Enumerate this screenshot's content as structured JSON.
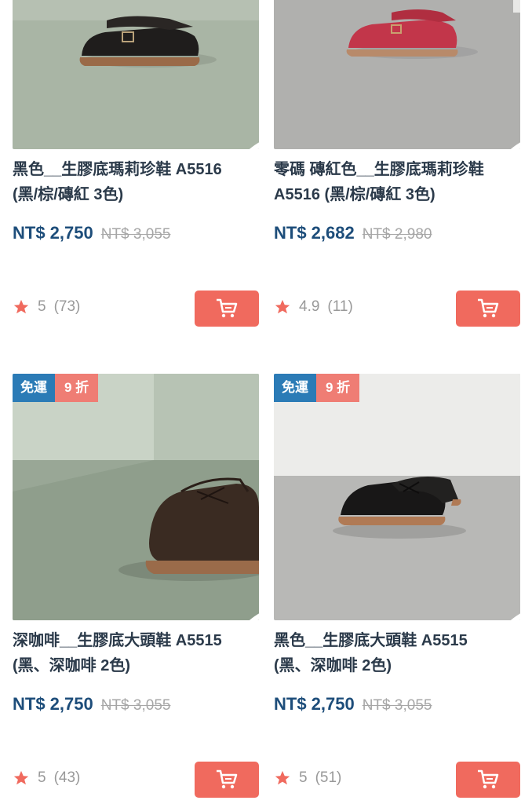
{
  "products": [
    {
      "title_line1": "黑色__生膠底瑪莉珍鞋 A5516",
      "title_line2": "(黑/棕/磚紅 3色)",
      "price": "NT$ 2,750",
      "original_price": "NT$ 3,055",
      "rating": "5",
      "reviews": "(73)",
      "image": "black-mary-jane-shoe",
      "badges": null
    },
    {
      "title_line1": "零碼 磚紅色__生膠底瑪莉珍鞋",
      "title_line2": "A5516 (黑/棕/磚紅 3色)",
      "price": "NT$ 2,682",
      "original_price": "NT$ 2,980",
      "rating": "4.9",
      "reviews": "(11)",
      "image": "red-mary-jane-shoe",
      "badges": null
    },
    {
      "title_line1": "深咖啡__生膠底大頭鞋 A5515",
      "title_line2": "(黑、深咖啡 2色)",
      "price": "NT$ 2,750",
      "original_price": "NT$ 3,055",
      "rating": "5",
      "reviews": "(43)",
      "image": "brown-derby-shoe",
      "badges": {
        "free_shipping": "免運",
        "discount": "9 折"
      }
    },
    {
      "title_line1": "黑色__生膠底大頭鞋 A5515",
      "title_line2": "(黑、深咖啡 2色)",
      "price": "NT$ 2,750",
      "original_price": "NT$ 3,055",
      "rating": "5",
      "reviews": "(51)",
      "image": "black-derby-shoe",
      "badges": {
        "free_shipping": "免運",
        "discount": "9 折"
      }
    }
  ],
  "icons": {
    "favorite": "heart-icon",
    "rating": "star-icon",
    "add_to_cart": "cart-icon"
  },
  "colors": {
    "price": "#1d4d7a",
    "cart_button": "#f06a5e",
    "star": "#f06a5e",
    "badge_free": "#2b7bb6",
    "badge_discount": "#ef7d74"
  }
}
